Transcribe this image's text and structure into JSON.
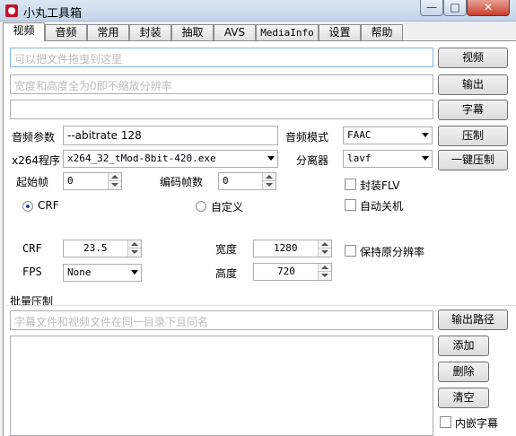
{
  "window": {
    "title": "小丸工具箱",
    "min": "—",
    "max": "□",
    "close": "✕"
  },
  "tabs": [
    "视频",
    "音频",
    "常用",
    "封装",
    "抽取",
    "AVS",
    "MediaInfo",
    "设置",
    "帮助"
  ],
  "video": {
    "video_input_placeholder": "可以把文件拖曳到这里",
    "output_placeholder": "宽度和高度全为0即不缩放分辨率",
    "video_button": "视频",
    "output_button": "输出",
    "subtitle_button": "字幕",
    "audio_param_label": "音频参数",
    "audio_param_value": "--abitrate 128",
    "audio_mode_label": "音频模式",
    "audio_mode_value": "FAAC",
    "compress_button": "压制",
    "x264_label": "x264程序",
    "x264_value": "x264_32_tMod-8bit-420.exe",
    "splitter_label": "分离器",
    "splitter_value": "lavf",
    "one_click_button": "一键压制",
    "start_frame_label": "起始帧",
    "start_frame_value": "0",
    "encode_frames_label": "编码帧数",
    "encode_frames_value": "0",
    "flv_label": "封装FLV",
    "shutdown_label": "自动关机",
    "crf_radio_label": "CRF",
    "custom_radio_label": "自定义",
    "crf_label": "CRF",
    "crf_value": "23.5",
    "fps_label": "FPS",
    "fps_value": "None",
    "width_label": "宽度",
    "width_value": "1280",
    "height_label": "高度",
    "height_value": "720",
    "keep_res_label": "保持原分辨率"
  },
  "batch": {
    "group_label": "批量压制",
    "hint_placeholder": "字幕文件和视频文件在同一目录下且同名",
    "output_path_button": "输出路径",
    "add_button": "添加",
    "delete_button": "删除",
    "clear_button": "清空",
    "embed_sub_label": "内嵌字幕"
  }
}
